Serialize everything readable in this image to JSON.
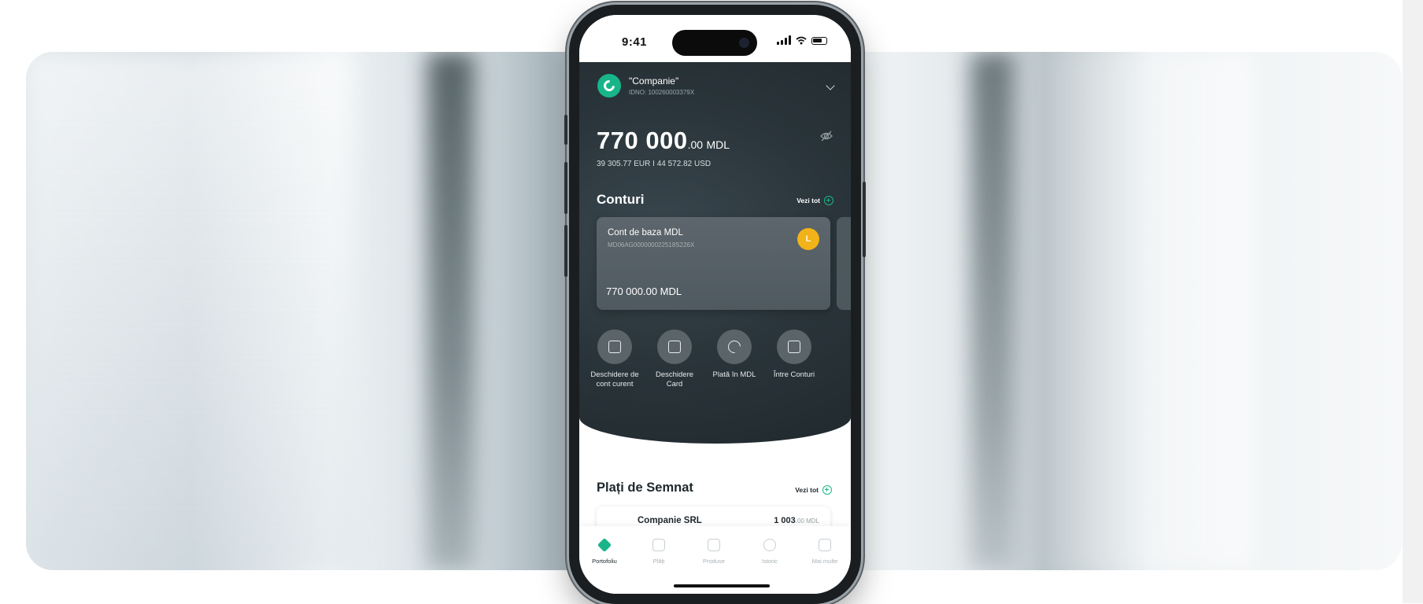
{
  "status_bar": {
    "time": "9:41"
  },
  "company": {
    "name": "\"Companie\"",
    "idno": "IDNO: 100260003379X"
  },
  "balance": {
    "integer": "770 000",
    "decimals": ".00",
    "currency": "MDL",
    "secondary": "39 305.77 EUR I 44 572.82 USD"
  },
  "accounts_section": {
    "title": "Conturi",
    "see_all": "Vezi tot"
  },
  "account_card": {
    "name": "Cont de baza MDL",
    "iban": "MD06AG000000022518S226X",
    "amount": "770 000.00 MDL",
    "coin_symbol": "L"
  },
  "actions": [
    {
      "label": "Deschidere de cont curent",
      "icon": "document-plus-icon"
    },
    {
      "label": "Deschidere Card",
      "icon": "card-plus-icon"
    },
    {
      "label": "Plată în MDL",
      "icon": "payment-arrow-icon"
    },
    {
      "label": "Între Conturi",
      "icon": "transfer-icon"
    }
  ],
  "sign_section": {
    "title": "Plați de Semnat",
    "see_all": "Vezi tot"
  },
  "payment": {
    "name": "Companie SRL",
    "amount": "1 003",
    "amount_suffix": ".00 MDL"
  },
  "bottom_nav": [
    {
      "label": "Portofoliu",
      "icon": "portfolio-icon",
      "active": true
    },
    {
      "label": "Plăți",
      "icon": "payments-icon",
      "active": false
    },
    {
      "label": "Produse",
      "icon": "products-icon",
      "active": false
    },
    {
      "label": "Istoric",
      "icon": "history-icon",
      "active": false
    },
    {
      "label": "Mai multe",
      "icon": "more-icon",
      "active": false
    }
  ],
  "colors": {
    "accent": "#19b58a",
    "dark_panel": "#2a353b",
    "coin": "#f2b31a"
  }
}
